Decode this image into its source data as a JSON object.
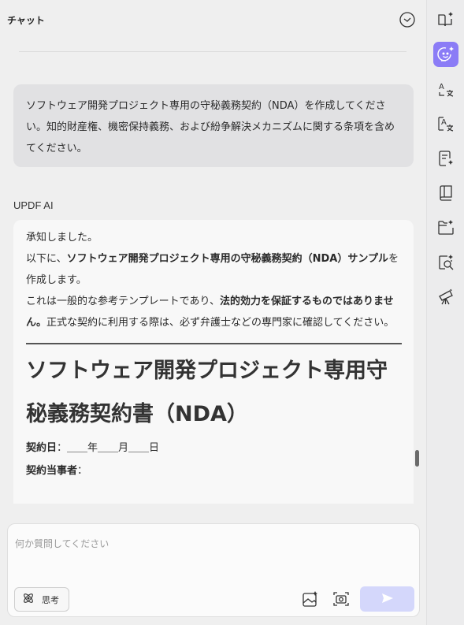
{
  "header": {
    "title": "チャット"
  },
  "user_message": {
    "text": "ソフトウェア開発プロジェクト専用の守秘義務契約（NDA）を作成してください。知的財産権、機密保持義務、および紛争解決メカニズムに関する条項を含めてください。"
  },
  "ai": {
    "label": "UPDF AI",
    "line1": "承知しました。",
    "line2_prefix": "以下に、",
    "line2_bold": "ソフトウェア開発プロジェクト専用の守秘義務契約（NDA）サンプル",
    "line2_suffix": "を作成します。",
    "line3_prefix": "これは一般的な参考テンプレートであり、",
    "line3_bold": "法的効力を保証するものではありません。",
    "line3_suffix": "正式な契約に利用する際は、必ず弁護士などの専門家に確認してください。",
    "doc_title": "ソフトウェア開発プロジェクト専用守秘義務契約書（NDA）",
    "date_label": "契約日",
    "date_value": "：＿＿年＿＿月＿＿日",
    "parties_label": "契約当事者",
    "parties_value": "："
  },
  "input": {
    "placeholder": "何か質問してください",
    "value": "",
    "think_label": "思考"
  },
  "colors": {
    "accent": "#8b7cf6",
    "send_bg": "#d4d7fb",
    "user_bubble": "#e1e1e3",
    "ai_bubble": "#f8f8f8"
  },
  "sidebar": {
    "items": [
      {
        "icon": "book-sparkle-icon"
      },
      {
        "icon": "ai-chat-icon",
        "active": true
      },
      {
        "icon": "translate-icon"
      },
      {
        "icon": "translate-alt-icon"
      },
      {
        "icon": "summarize-icon"
      },
      {
        "icon": "knowledge-book-icon"
      },
      {
        "icon": "folder-sparkle-icon"
      },
      {
        "icon": "search-document-icon"
      },
      {
        "icon": "telescope-icon"
      }
    ]
  }
}
